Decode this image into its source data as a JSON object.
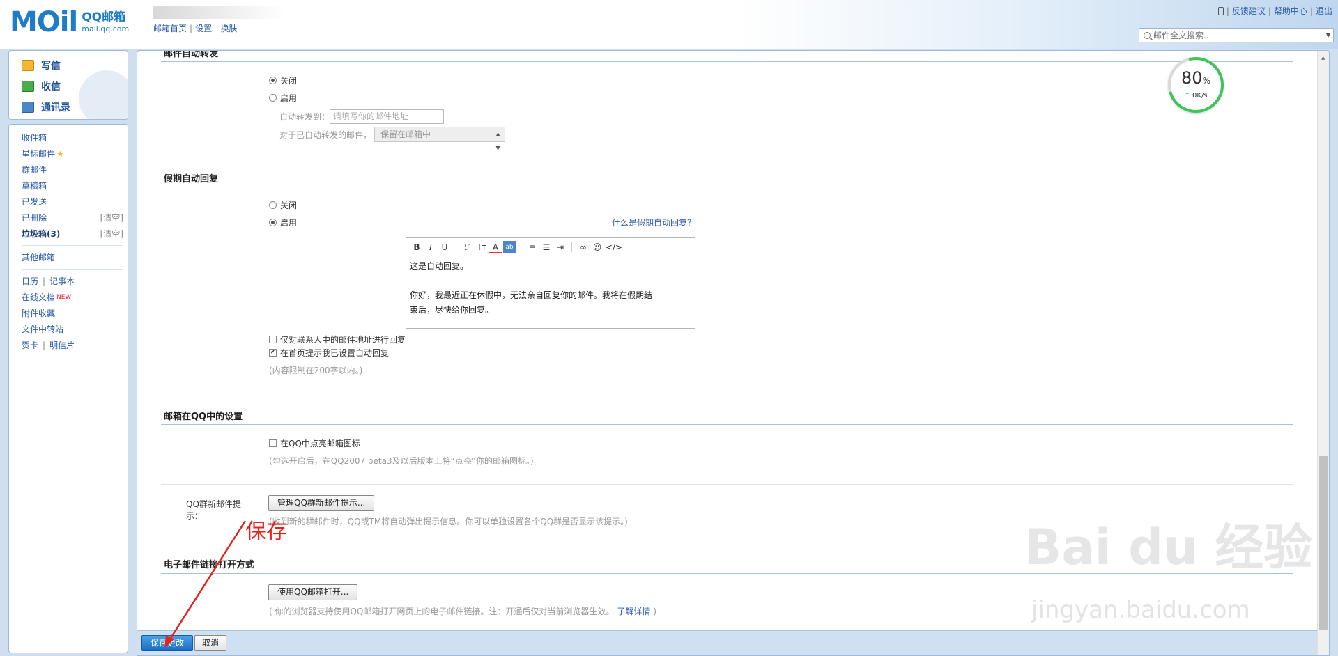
{
  "header": {
    "logo_main": "MOil",
    "logo_title": "QQ邮箱",
    "logo_domain": "mail.qq.com",
    "nav": [
      "邮箱首页",
      "设置",
      "换肤"
    ],
    "links": [
      "反馈建议",
      "帮助中心",
      "退出"
    ],
    "search_placeholder": "邮件全文搜索..."
  },
  "sidebar": {
    "actions": [
      "写信",
      "收信",
      "通讯录"
    ],
    "folders": [
      {
        "label": "收件箱"
      },
      {
        "label": "星标邮件"
      },
      {
        "label": "群邮件"
      },
      {
        "label": "草稿箱"
      },
      {
        "label": "已发送"
      },
      {
        "label": "已删除",
        "action": "[清空]"
      },
      {
        "label": "垃圾箱(3)",
        "action": "[清空]"
      }
    ],
    "other": "其他邮箱",
    "tools": {
      "calendar": "日历",
      "notes": "记事本",
      "docs": "在线文档",
      "docs_badge": "NEW",
      "attachments": "附件收藏",
      "transfer": "文件中转站",
      "cards": "贺卡",
      "postcards": "明信片"
    }
  },
  "forward": {
    "title": "邮件自动转发",
    "off": "关闭",
    "on": "启用",
    "to_label": "自动转发到：",
    "to_placeholder": "请填写你的邮件地址",
    "keep_label": "对于已自动转发的邮件，",
    "keep_value": "保留在邮箱中"
  },
  "vacation": {
    "title": "假期自动回复",
    "off": "关闭",
    "on": "启用",
    "help_link": "什么是假期自动回复？",
    "toolbar": [
      "B",
      "I",
      "U"
    ],
    "body_line1": "这是自动回复。",
    "body_line2": "你好，我最近正在休假中，无法亲自回复你的邮件。我将在假期结",
    "body_line3": "束后，尽快给你回复。",
    "opt_contacts": "仅对联系人中的邮件地址进行回复",
    "opt_home": "在首页提示我已设置自动回复",
    "limit": "(内容限制在200字以内。)"
  },
  "qq": {
    "title": "邮箱在QQ中的设置",
    "light_icon": "在QQ中点亮邮箱图标",
    "light_hint": "(勾选开启后，在QQ2007 beta3及以后版本上将“点亮”你的邮箱图标。)",
    "group_label": "QQ群新邮件提示：",
    "group_button": "管理QQ群新邮件提示...",
    "group_hint": "(收到新的群邮件时，QQ或TM将自动弹出提示信息。你可以单独设置各个QQ群是否显示该提示。)"
  },
  "links_open": {
    "title": "电子邮件链接打开方式",
    "button": "使用QQ邮箱打开...",
    "hint": "( 你的浏览器支持使用QQ邮箱打开网页上的电子邮件链接。注：开通后仅对当前浏览器生效。",
    "more": "了解详情",
    "hint_end": ")"
  },
  "footer": {
    "save": "保存更改",
    "cancel": "取消"
  },
  "speed_widget": {
    "percent": "80",
    "unit": "%",
    "rate": "0K/s"
  },
  "annotation": {
    "label": "保存",
    "color": "#e3241d"
  },
  "watermark": {
    "brand": "Bai du 经验",
    "url": "jingyan.baidu.com"
  }
}
